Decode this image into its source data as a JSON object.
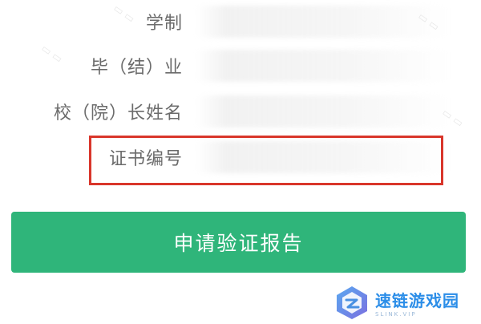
{
  "form": {
    "rows": [
      {
        "label": "学制"
      },
      {
        "label": "毕（结）业"
      },
      {
        "label": "校（院）长姓名"
      },
      {
        "label": "证书编号"
      }
    ]
  },
  "submit": {
    "label": "申请验证报告"
  },
  "logo": {
    "title": "速链游戏园",
    "subtitle": "SLINK.VIP"
  },
  "colors": {
    "accent": "#2fb57a",
    "highlight": "#d9362b",
    "label": "#6b6b6b"
  }
}
